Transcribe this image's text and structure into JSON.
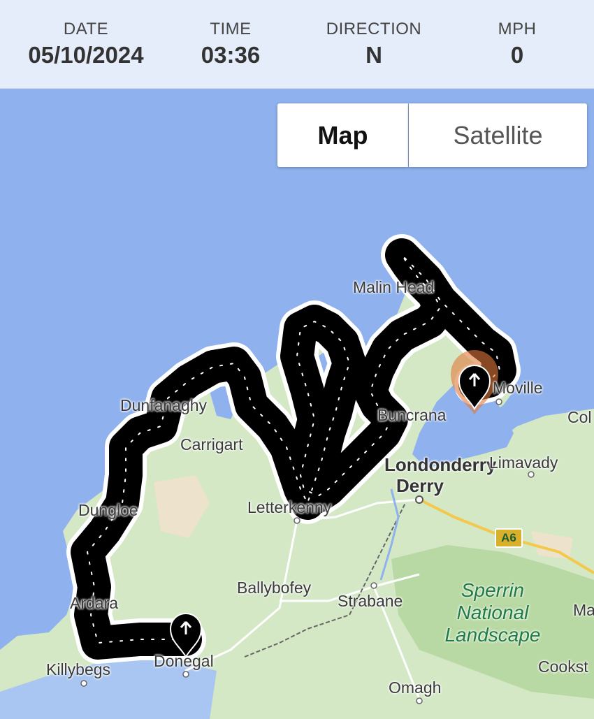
{
  "header": {
    "date_label": "DATE",
    "date_value": "05/10/2024",
    "time_label": "TIME",
    "time_value": "03:36",
    "direction_label": "DIRECTION",
    "direction_value": "N",
    "mph_label": "MPH",
    "mph_value": "0"
  },
  "map_type": {
    "map_label": "Map",
    "satellite_label": "Satellite",
    "selected": "Map"
  },
  "places": {
    "malin_head": "Malin Head",
    "moville": "Moville",
    "coleraine": "Col",
    "dunfanaghy": "Dunfanaghy",
    "carrigart": "Carrigart",
    "buncrana": "Buncrana",
    "londonderry": "Londonderry",
    "derry": "Derry",
    "limavady": "Limavady",
    "dungloe": "Dungloe",
    "letterkenny": "Letterkenny",
    "ardara": "Ardara",
    "ballybofey": "Ballybofey",
    "strabane": "Strabane",
    "killybegs": "Killybegs",
    "donegal": "Donegal",
    "omagh": "Omagh",
    "cookstown": "Cookst",
    "magherafelt": "Ma",
    "road_a6": "A6",
    "park_name": "Sperrin National Landscape"
  },
  "colors": {
    "sea": "#8fb1ee",
    "land": "#d4e8c6",
    "track": "#000000",
    "current_marker_halo": "#e07a3a",
    "header_bg": "#e6edfa"
  },
  "icons": {
    "marker_start": "arrow-up-pin-icon",
    "marker_current": "arrow-up-pin-icon"
  }
}
